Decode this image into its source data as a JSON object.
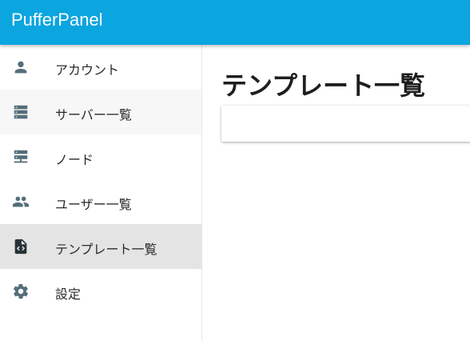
{
  "app": {
    "title": "PufferPanel"
  },
  "sidebar": {
    "items": [
      {
        "label": "アカウント",
        "icon": "account-icon"
      },
      {
        "label": "サーバー一覧",
        "icon": "servers-icon"
      },
      {
        "label": "ノード",
        "icon": "nodes-icon"
      },
      {
        "label": "ユーザー一覧",
        "icon": "users-icon"
      },
      {
        "label": "テンプレート一覧",
        "icon": "template-file-icon"
      },
      {
        "label": "設定",
        "icon": "gear-icon"
      }
    ],
    "active_item": "テンプレート一覧"
  },
  "main": {
    "page_title": "テンプレート一覧"
  },
  "colors": {
    "appbar": "#0ba5e0",
    "active_item_bg": "#e4e4e4",
    "icon": "#546e7a"
  }
}
